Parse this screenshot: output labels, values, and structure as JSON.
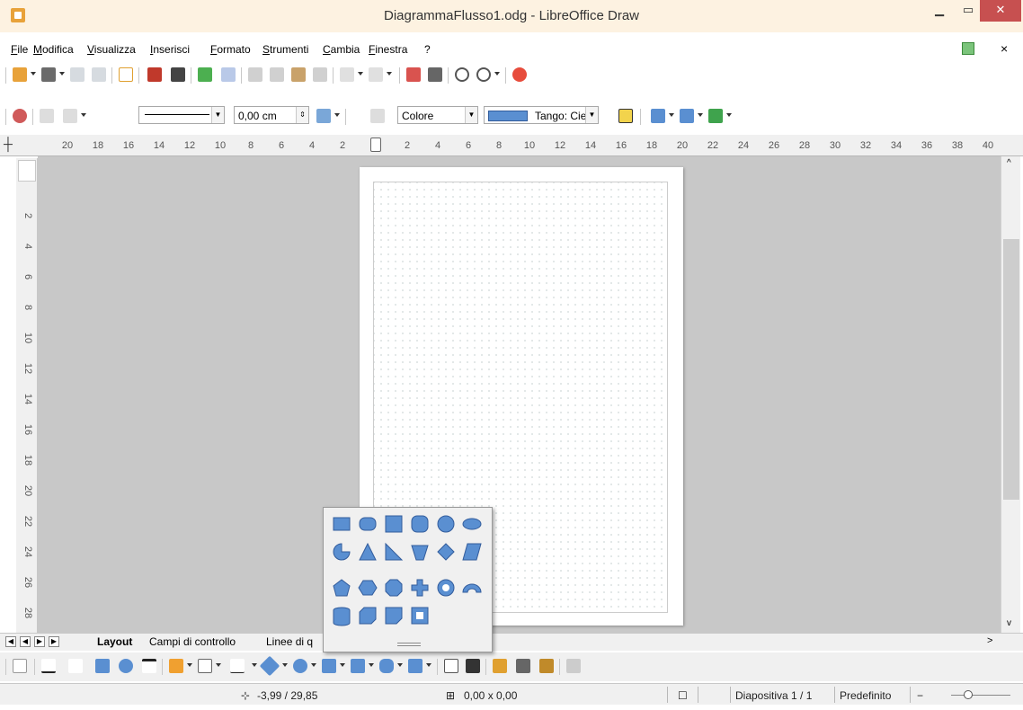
{
  "window": {
    "title": "DiagrammaFlusso1.odg - LibreOffice Draw",
    "min_icon": "minimize-icon",
    "max_icon": "maximize-icon",
    "close_icon": "close-icon"
  },
  "menu": {
    "items": [
      "File",
      "Modifica",
      "Visualizza",
      "Inserisci",
      "Formato",
      "Strumenti",
      "Cambia",
      "Finestra",
      "?"
    ],
    "close_glyph": "×"
  },
  "line_toolbar": {
    "width_value": "0,00 cm",
    "area_style": "Colore",
    "area_color_name": "Tango: Cie",
    "area_color": "#5a8fd1"
  },
  "ruler": {
    "h_labels": [
      "20",
      "18",
      "16",
      "14",
      "12",
      "10",
      "8",
      "6",
      "4",
      "2",
      "2",
      "4",
      "6",
      "8",
      "10",
      "12",
      "14",
      "16",
      "18",
      "20",
      "22",
      "24",
      "26",
      "28",
      "30",
      "32",
      "34",
      "36",
      "38",
      "40"
    ],
    "v_labels": [
      "2",
      "4",
      "6",
      "8",
      "10",
      "12",
      "14",
      "16",
      "18",
      "20",
      "22",
      "24",
      "26",
      "28"
    ]
  },
  "tabs": [
    "Layout",
    "Campi di controllo",
    "Linee di q"
  ],
  "status": {
    "position": "-3,99 / 29,85",
    "size": "0,00 x 0,00",
    "slide": "Diapositiva 1 / 1",
    "layout": "Predefinito"
  },
  "colors": {
    "shape_fill": "#5a8fd1",
    "shape_stroke": "#325c9c",
    "titlebar": "#fdf2e1",
    "close_red": "#c75050"
  }
}
